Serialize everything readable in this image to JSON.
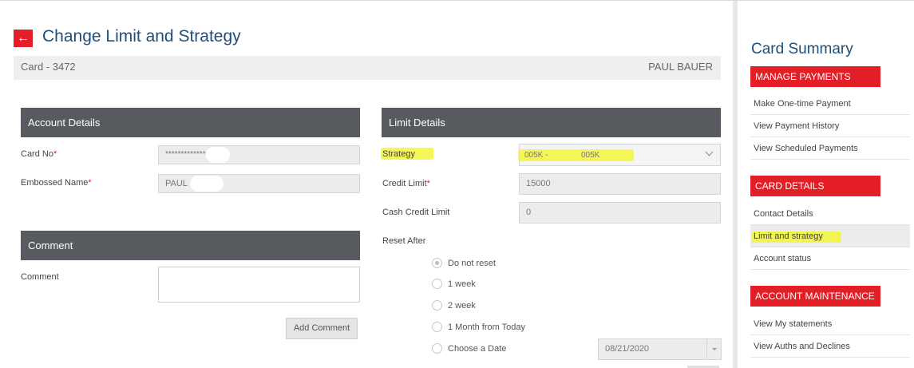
{
  "header": {
    "back_icon": "arrow-left-icon",
    "title": "Change Limit and Strategy"
  },
  "card_bar": {
    "card_number": "Card - 3472",
    "holder_name": "PAUL BAUER"
  },
  "account_details": {
    "heading": "Account Details",
    "card_no_label": "Card No",
    "card_no_value": "*************",
    "embossed_name_label": "Embossed Name",
    "embossed_name_value": "PAUL B",
    "required_mark": "*"
  },
  "comment": {
    "heading": "Comment",
    "label": "Comment",
    "button": "Add Comment"
  },
  "limit_details": {
    "heading": "Limit Details",
    "strategy_label": "Strategy",
    "strategy_code": "005K -",
    "strategy_name": "005K",
    "credit_limit_label": "Credit Limit",
    "credit_limit_value": "15000",
    "cash_credit_limit_label": "Cash Credit Limit",
    "cash_credit_limit_value": "0",
    "reset_after_label": "Reset After",
    "reset_options": [
      "Do not reset",
      "1 week",
      "2 week",
      "1 Month from Today",
      "Choose a Date"
    ],
    "selected_reset": "Do not reset",
    "date_value": "08/21/2020"
  },
  "sidebar": {
    "title": "Card Summary",
    "sections": [
      {
        "heading": "MANAGE PAYMENTS",
        "items": [
          "Make One-time Payment",
          "View Payment History",
          "View Scheduled Payments"
        ]
      },
      {
        "heading": "CARD DETAILS",
        "items": [
          "Contact Details",
          "Limit and strategy",
          "Account status"
        ]
      },
      {
        "heading": "ACCOUNT MAINTENANCE",
        "items": [
          "View My statements",
          "View Auths and Declines"
        ]
      }
    ],
    "active_item": "Limit and strategy"
  },
  "colors": {
    "brand_red": "#e31e26",
    "header_dark": "#575a5f",
    "title_blue": "#1f4e79",
    "highlight_yellow": "#f3f53a"
  }
}
